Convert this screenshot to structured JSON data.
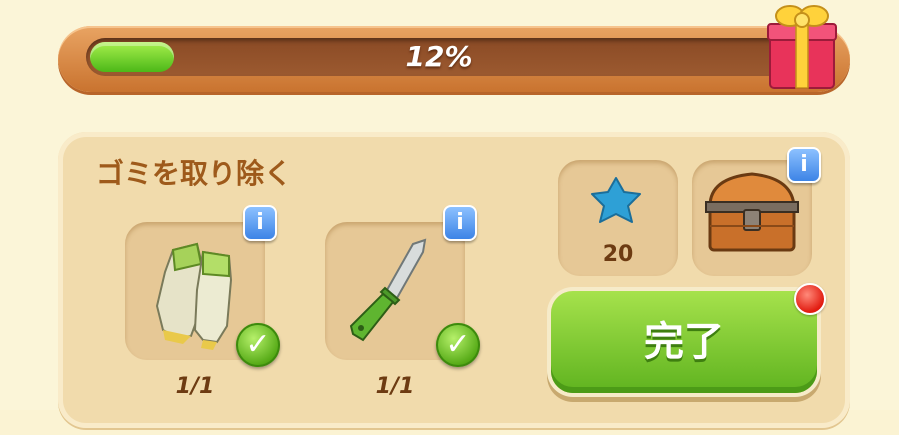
{
  "progress": {
    "percent_text": "12%",
    "value": 0.12
  },
  "task": {
    "title": "ゴミを取り除く",
    "requirements": [
      {
        "icon": "gloves-icon",
        "count_text": "1/1",
        "completed": true
      },
      {
        "icon": "knife-icon",
        "count_text": "1/1",
        "completed": true
      }
    ]
  },
  "rewards": [
    {
      "icon": "blue-star-icon",
      "amount_text": "20"
    },
    {
      "icon": "treasure-chest-icon"
    }
  ],
  "complete_button": {
    "label": "完了"
  },
  "info_label": "i",
  "colors": {
    "accent_green": "#5fb31f",
    "progress_frame": "#c9732f",
    "title_brown": "#9e5a1b",
    "info_blue": "#3d84e6"
  }
}
